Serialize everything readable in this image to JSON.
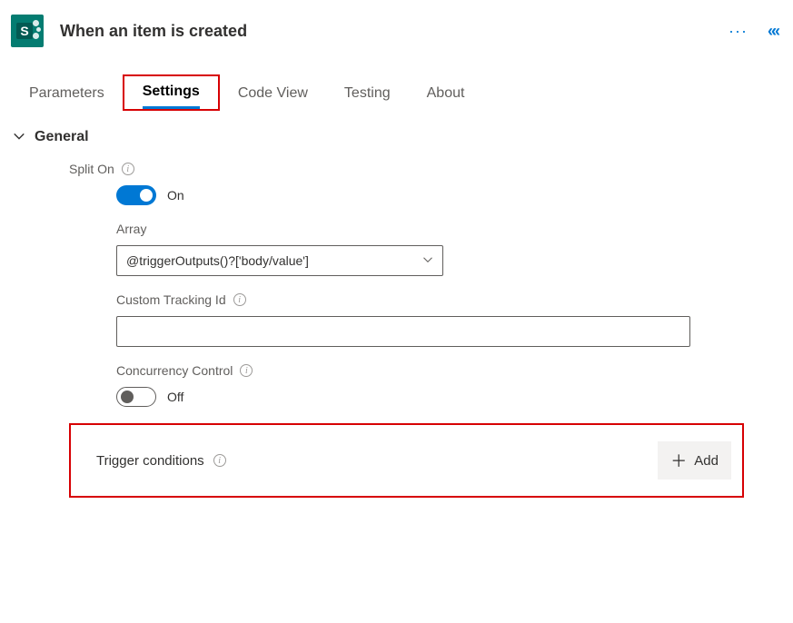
{
  "header": {
    "title": "When an item is created"
  },
  "tabs": {
    "items": [
      {
        "label": "Parameters"
      },
      {
        "label": "Settings"
      },
      {
        "label": "Code View"
      },
      {
        "label": "Testing"
      },
      {
        "label": "About"
      }
    ]
  },
  "section": {
    "title": "General"
  },
  "splitOn": {
    "label": "Split On",
    "state": "On"
  },
  "array": {
    "label": "Array",
    "value": "@triggerOutputs()?['body/value']"
  },
  "tracking": {
    "label": "Custom Tracking Id",
    "value": ""
  },
  "concurrency": {
    "label": "Concurrency Control",
    "state": "Off"
  },
  "trigger": {
    "label": "Trigger conditions",
    "addLabel": "Add"
  }
}
